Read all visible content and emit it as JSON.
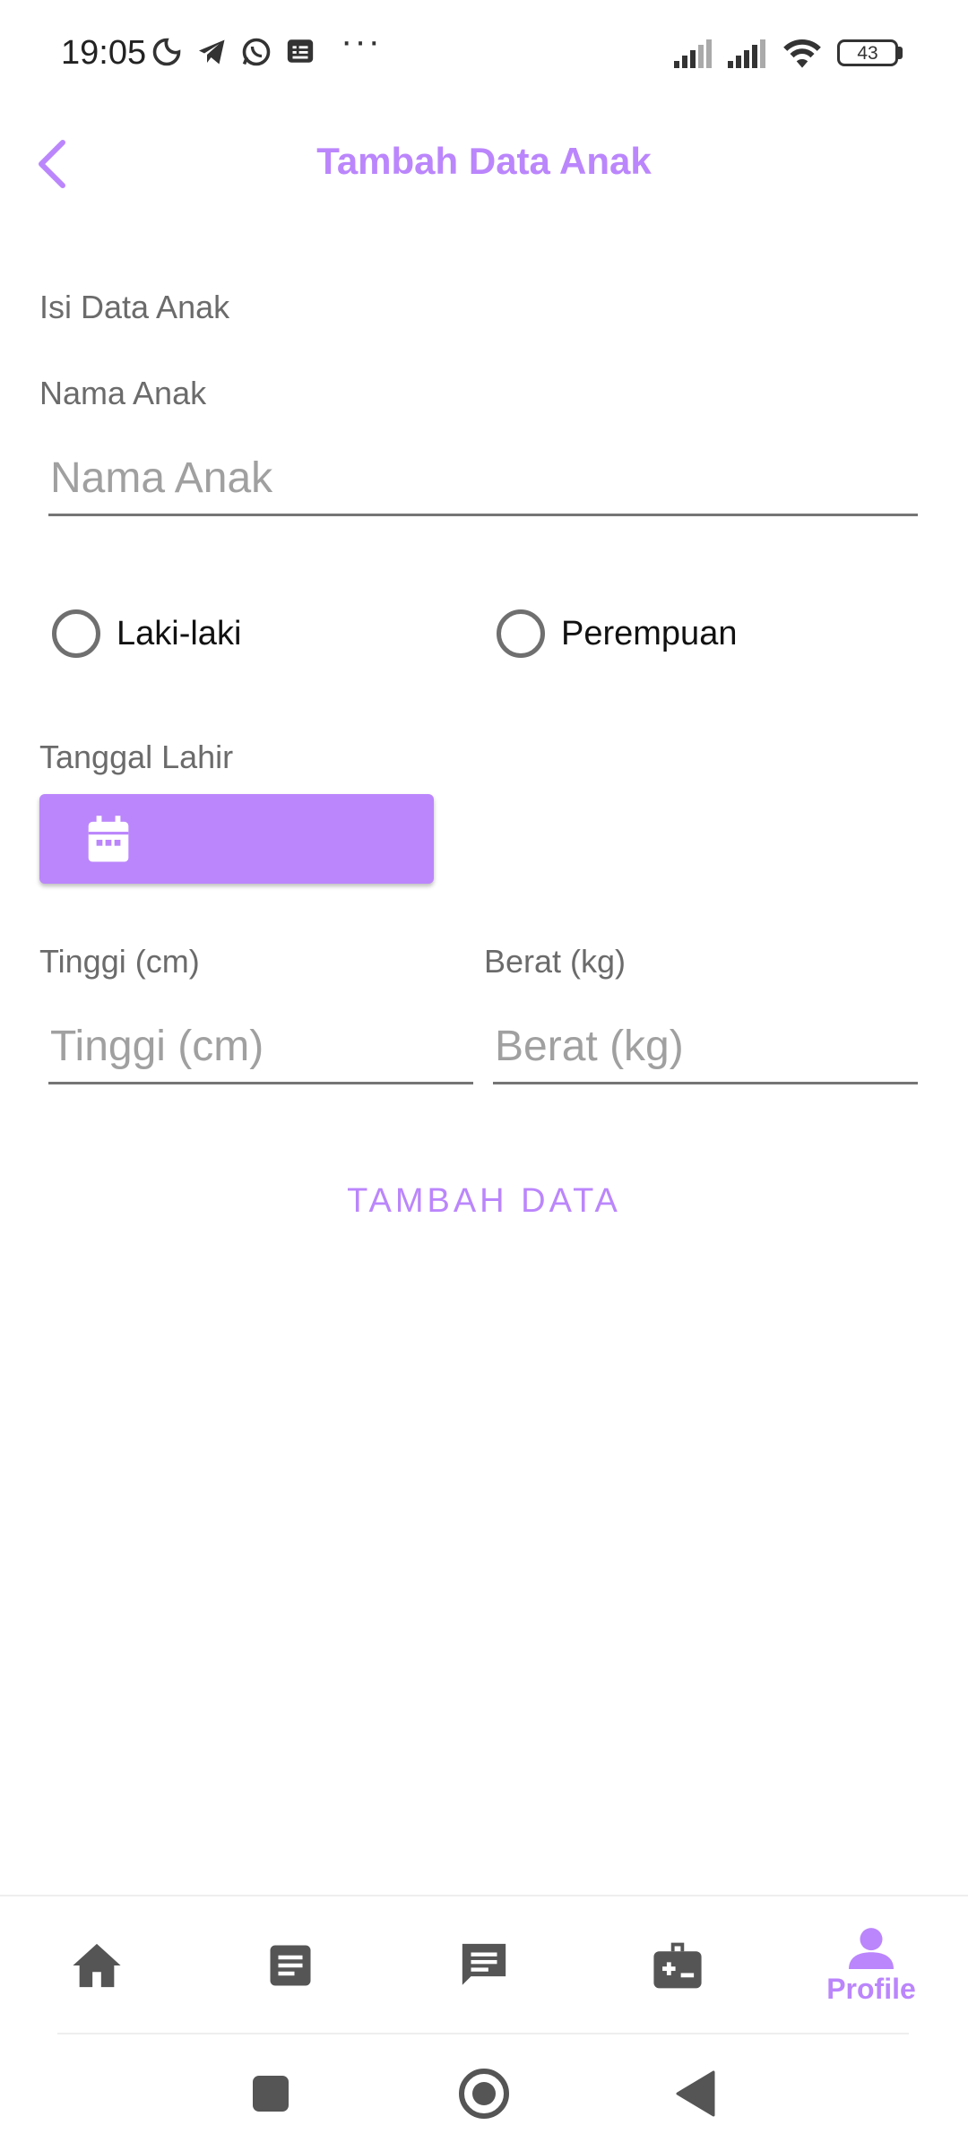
{
  "status_bar": {
    "time": "19:05",
    "icons": [
      "moon-icon",
      "telegram-icon",
      "whatsapp-icon",
      "news-icon"
    ],
    "more": "···",
    "battery": "43"
  },
  "header": {
    "title": "Tambah Data Anak",
    "back_icon": "chevron-left-icon"
  },
  "form": {
    "section_title": "Isi Data Anak",
    "name_label": "Nama Anak",
    "name_placeholder": "Nama Anak",
    "name_value": "",
    "gender_options": [
      "Laki-laki",
      "Perempuan"
    ],
    "gender_selected": null,
    "birth_label": "Tanggal Lahir",
    "birth_icon": "calendar-icon",
    "height_label": "Tinggi (cm)",
    "height_placeholder": "Tinggi (cm)",
    "weight_label": "Berat (kg)",
    "weight_placeholder": "Berat (kg)",
    "submit_label": "TAMBAH DATA"
  },
  "bottom_nav": {
    "items": [
      {
        "icon": "home-icon",
        "label": "",
        "active": false
      },
      {
        "icon": "article-icon",
        "label": "",
        "active": false
      },
      {
        "icon": "chat-icon",
        "label": "",
        "active": false
      },
      {
        "icon": "medical-kit-icon",
        "label": "",
        "active": false
      },
      {
        "icon": "person-icon",
        "label": "Profile",
        "active": true
      }
    ]
  },
  "colors": {
    "accent": "#bb86fc",
    "icon_inactive": "#555555",
    "label_gray": "#6b6b6b"
  }
}
